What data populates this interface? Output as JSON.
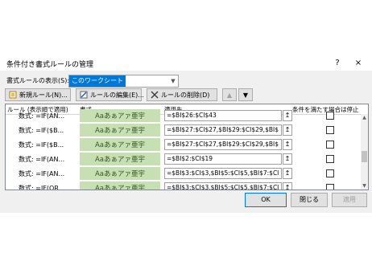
{
  "dialog": {
    "title": "条件付き書式ルールの管理",
    "help_glyph": "?",
    "close_glyph": "×"
  },
  "show_rules": {
    "label": "書式ルールの表示(S):",
    "selected": "このワークシート"
  },
  "toolbar": {
    "new_rule": "新規ルール(N)...",
    "edit_rule": "ルールの編集(E)...",
    "delete_rule": "ルールの削除(D)",
    "move_up_glyph": "▲",
    "move_down_glyph": "▼"
  },
  "table": {
    "headers": [
      "ルール (表示順で適用)",
      "書式",
      "適用先",
      "条件を満たす場合は停止"
    ],
    "rows": [
      {
        "rule": "数式: =IF(AN...",
        "format": "Aaあぁアァ亜宇",
        "range": "=$BI$26:$CI$43"
      },
      {
        "rule": "数式: =IF($B...",
        "format": "Aaあぁアァ亜宇",
        "range": "=$BI$27:$CI$27,$BI$29:$CI$29,$BI$"
      },
      {
        "rule": "数式: =IF($B...",
        "format": "Aaあぁアァ亜宇",
        "range": "=$BI$27:$CI$27,$BI$29:$CI$29,$BI$"
      },
      {
        "rule": "数式: =IF(AN...",
        "format": "Aaあぁアァ亜宇",
        "range": "=$BI$2:$CI$19"
      },
      {
        "rule": "数式: =IF(AN...",
        "format": "Aaあぁアァ亜宇",
        "range": "=$BI$3:$CI$3,$BI$5:$CI$5,$BI$7:$CI"
      },
      {
        "rule": "数式: =IF(OR...",
        "format": "Aaあぁアァ亜宇",
        "range": "=$BI$3:$CI$3,$BI$5:$CI$5,$BI$7:$CI"
      }
    ]
  },
  "footer": {
    "ok": "OK",
    "close": "閉じる",
    "apply": "適用"
  },
  "icons": {
    "range_picker": "range-picker-icon",
    "new_rule": "new-rule-icon",
    "edit_rule": "edit-rule-icon",
    "delete_rule": "delete-icon"
  },
  "colors": {
    "format_preview_bg": "#c6e0b4",
    "format_preview_text": "#385723",
    "selection": "#0078d7"
  }
}
